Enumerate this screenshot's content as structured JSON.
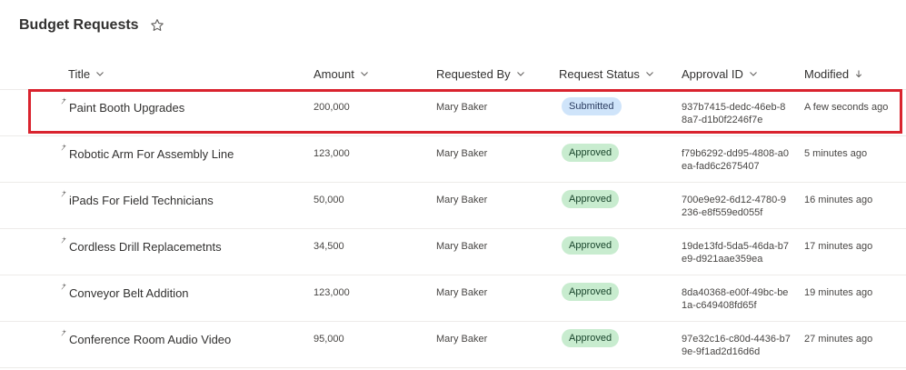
{
  "list": {
    "title": "Budget Requests"
  },
  "columns": {
    "title": "Title",
    "amount": "Amount",
    "requested_by": "Requested By",
    "status": "Request Status",
    "approval_id": "Approval ID",
    "modified": "Modified"
  },
  "icons": {
    "favorite": "star-icon",
    "sort": "chevron-down-icon",
    "sorted_desc": "arrow-down-icon",
    "new_item": "new-item-icon"
  },
  "colors": {
    "submitted_bg": "#cfe4fa",
    "approved_bg": "#c8eccf",
    "highlight": "#d9232e"
  },
  "rows": [
    {
      "title": "Paint Booth Upgrades",
      "amount": "200,000",
      "requested_by": "Mary Baker",
      "status": "Submitted",
      "approval_id": "937b7415-dedc-46eb-88a7-d1b0f2246f7e",
      "modified": "A few seconds ago"
    },
    {
      "title": "Robotic Arm For Assembly Line",
      "amount": "123,000",
      "requested_by": "Mary Baker",
      "status": "Approved",
      "approval_id": "f79b6292-dd95-4808-a0ea-fad6c2675407",
      "modified": "5 minutes ago"
    },
    {
      "title": "iPads For Field Technicians",
      "amount": "50,000",
      "requested_by": "Mary Baker",
      "status": "Approved",
      "approval_id": "700e9e92-6d12-4780-9236-e8f559ed055f",
      "modified": "16 minutes ago"
    },
    {
      "title": "Cordless Drill Replacemetnts",
      "amount": "34,500",
      "requested_by": "Mary Baker",
      "status": "Approved",
      "approval_id": "19de13fd-5da5-46da-b7e9-d921aae359ea",
      "modified": "17 minutes ago"
    },
    {
      "title": "Conveyor Belt Addition",
      "amount": "123,000",
      "requested_by": "Mary Baker",
      "status": "Approved",
      "approval_id": "8da40368-e00f-49bc-be1a-c649408fd65f",
      "modified": "19 minutes ago"
    },
    {
      "title": "Conference Room Audio Video",
      "amount": "95,000",
      "requested_by": "Mary Baker",
      "status": "Approved",
      "approval_id": "97e32c16-c80d-4436-b79e-9f1ad2d16d6d",
      "modified": "27 minutes ago"
    }
  ]
}
